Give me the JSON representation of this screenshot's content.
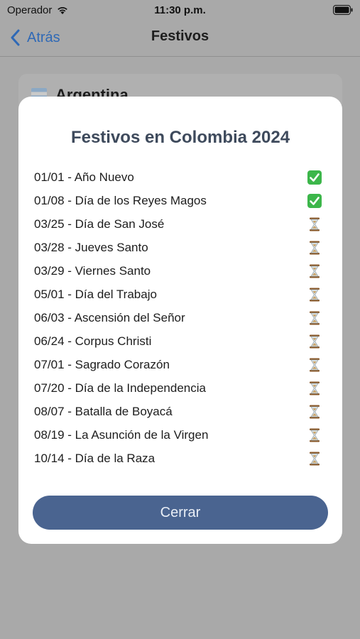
{
  "status_bar": {
    "carrier": "Operador",
    "time": "11:30 p.m."
  },
  "nav": {
    "back_label": "Atrás",
    "title": "Festivos"
  },
  "background_card": {
    "country": "Argentina"
  },
  "modal": {
    "title": "Festivos en Colombia 2024",
    "holidays": [
      {
        "text": "01/01 - Año Nuevo",
        "status": "passed",
        "icon": "check-icon"
      },
      {
        "text": "01/08 - Día de los Reyes Magos",
        "status": "passed",
        "icon": "check-icon"
      },
      {
        "text": "03/25 - Día de San José",
        "status": "upcoming",
        "icon": "hourglass-icon"
      },
      {
        "text": "03/28 - Jueves Santo",
        "status": "upcoming",
        "icon": "hourglass-icon"
      },
      {
        "text": "03/29 - Viernes Santo",
        "status": "upcoming",
        "icon": "hourglass-icon"
      },
      {
        "text": "05/01 - Día del Trabajo",
        "status": "upcoming",
        "icon": "hourglass-icon"
      },
      {
        "text": "06/03 - Ascensión del Señor",
        "status": "upcoming",
        "icon": "hourglass-icon"
      },
      {
        "text": "06/24 - Corpus Christi",
        "status": "upcoming",
        "icon": "hourglass-icon"
      },
      {
        "text": "07/01 - Sagrado Corazón",
        "status": "upcoming",
        "icon": "hourglass-icon"
      },
      {
        "text": "07/20 - Día de la Independencia",
        "status": "upcoming",
        "icon": "hourglass-icon"
      },
      {
        "text": "08/07 - Batalla de Boyacá",
        "status": "upcoming",
        "icon": "hourglass-icon"
      },
      {
        "text": "08/19 - La Asunción de la Virgen",
        "status": "upcoming",
        "icon": "hourglass-icon"
      },
      {
        "text": "10/14 - Día de la Raza",
        "status": "upcoming",
        "icon": "hourglass-icon"
      }
    ],
    "close_label": "Cerrar"
  },
  "colors": {
    "accent": "#2f69b6",
    "button": "#4a6490",
    "title": "#3e4a5c",
    "check": "#3cb64a",
    "overlay": "#a9a9a9"
  }
}
